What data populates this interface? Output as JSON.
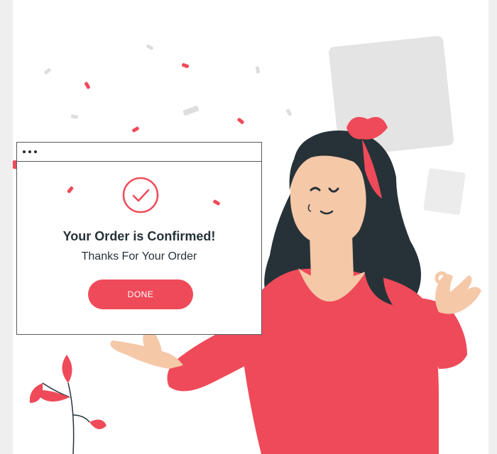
{
  "dialog": {
    "title": "Your Order is Confirmed!",
    "subtitle": "Thanks For Your Order",
    "done_label": "DONE"
  },
  "colors": {
    "accent": "#ef4a59",
    "text_dark": "#263238",
    "hair": "#263238",
    "skin": "#f5c8a8"
  },
  "icons": [
    "check-circle-icon",
    "window-dots-icon"
  ]
}
